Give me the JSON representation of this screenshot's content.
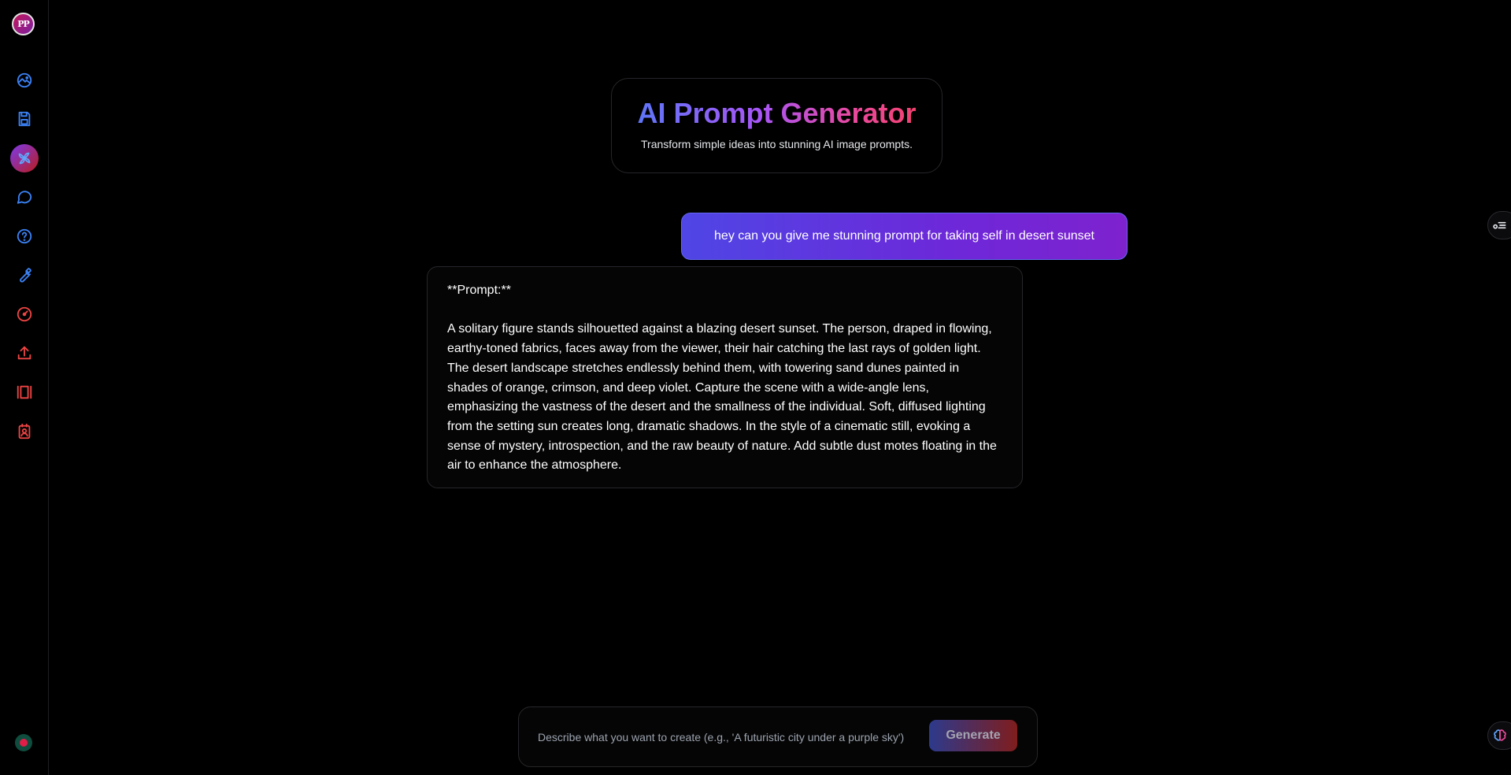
{
  "sidebar": {
    "avatar_text": "PP",
    "items": [
      {
        "name": "gallery",
        "icon": "image-circle-icon",
        "color": "#3b82f6"
      },
      {
        "name": "saved",
        "icon": "save-icon",
        "color": "#3b82f6"
      },
      {
        "name": "prompt-generator",
        "icon": "pinwheel-icon",
        "color": "#60a5fa",
        "active": true
      },
      {
        "name": "chat",
        "icon": "chat-bubble-icon",
        "color": "#3b82f6"
      },
      {
        "name": "help",
        "icon": "help-circle-icon",
        "color": "#3b82f6"
      },
      {
        "name": "tools",
        "icon": "wrench-icon",
        "color": "#3b82f6"
      },
      {
        "name": "dashboard",
        "icon": "gauge-icon",
        "color": "#ef4444"
      },
      {
        "name": "upload",
        "icon": "upload-icon",
        "color": "#ef4444"
      },
      {
        "name": "library",
        "icon": "library-icon",
        "color": "#ef4444"
      },
      {
        "name": "profile",
        "icon": "id-badge-icon",
        "color": "#ef4444"
      }
    ]
  },
  "header": {
    "title": "AI Prompt Generator",
    "subtitle": "Transform simple ideas into stunning AI image prompts."
  },
  "chat": {
    "user_message": "hey can you give me stunning prompt for taking self in desert sunset",
    "ai_heading": "**Prompt:**",
    "ai_body": "A solitary figure stands silhouetted against a blazing desert sunset. The person, draped in flowing, earthy-toned fabrics, faces away from the viewer, their hair catching the last rays of golden light. The desert landscape stretches endlessly behind them, with towering sand dunes painted in shades of orange, crimson, and deep violet. Capture the scene with a wide-angle lens, emphasizing the vastness of the desert and the smallness of the individual. Soft, diffused lighting from the setting sun creates long, dramatic shadows. In the style of a cinematic still, evoking a sense of mystery, introspection, and the raw beauty of nature. Add subtle dust motes floating in the air to enhance the atmosphere."
  },
  "input": {
    "placeholder": "Describe what you want to create (e.g., 'A futuristic city under a purple sky')",
    "value": "",
    "button_label": "Generate"
  },
  "colors": {
    "accent_blue": "#3b82f6",
    "accent_red": "#ef4444",
    "title_gradient": [
      "#4f7cf7",
      "#a855f7",
      "#ec4899",
      "#f43f5e"
    ],
    "user_bubble": [
      "#4f46e5",
      "#7e22ce"
    ]
  }
}
